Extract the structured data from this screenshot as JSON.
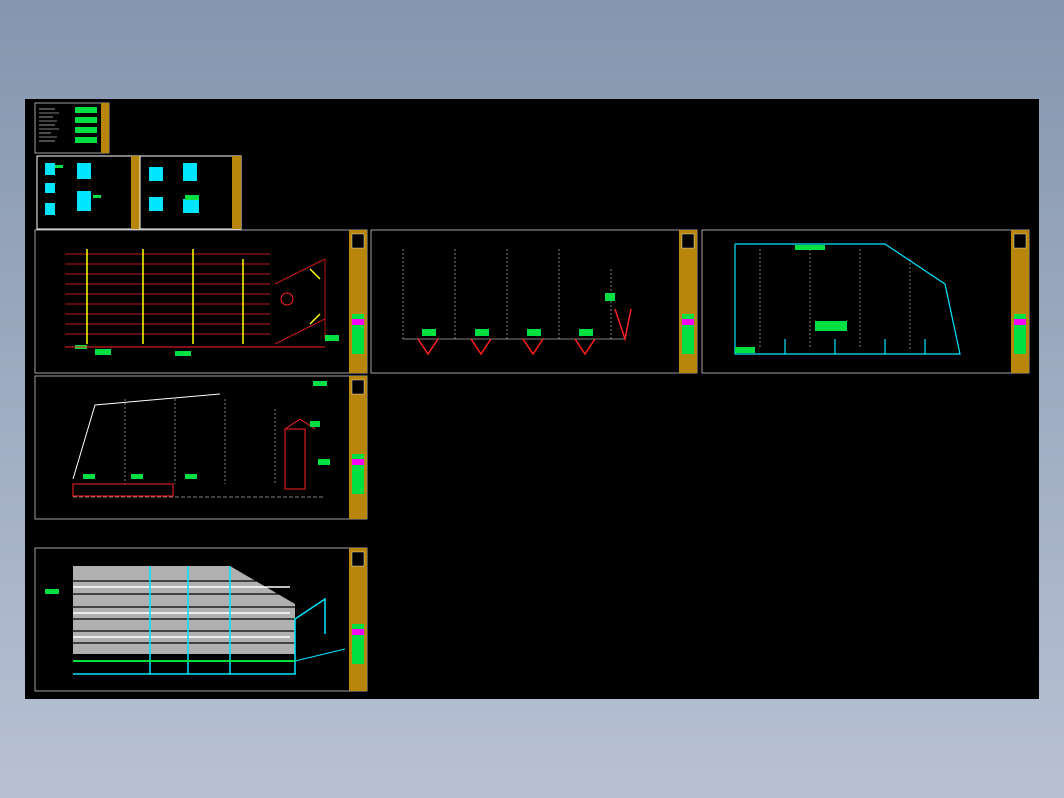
{
  "app": {
    "kind": "CAD drawing preview",
    "background_color": "#8496ae",
    "canvas_color": "#000000"
  },
  "colors": {
    "frame": "#c8c8c8",
    "title_block": "#b8860b",
    "cyan": "#00e5ff",
    "green": "#00e040",
    "red": "#ff2020",
    "magenta": "#ff00ff",
    "yellow": "#ffff00",
    "white": "#ffffff",
    "gray_fill": "#b0b0b0"
  },
  "sheets": [
    {
      "id": "legend-sheet",
      "description_icon": "text-notes-icon"
    },
    {
      "id": "detail-sheet-a"
    },
    {
      "id": "detail-sheet-b"
    },
    {
      "id": "elevation-red-sheet"
    },
    {
      "id": "section-sheet"
    },
    {
      "id": "plan-cyan-sheet"
    },
    {
      "id": "elevation-white-sheet"
    },
    {
      "id": "gray-plan-sheet"
    }
  ]
}
